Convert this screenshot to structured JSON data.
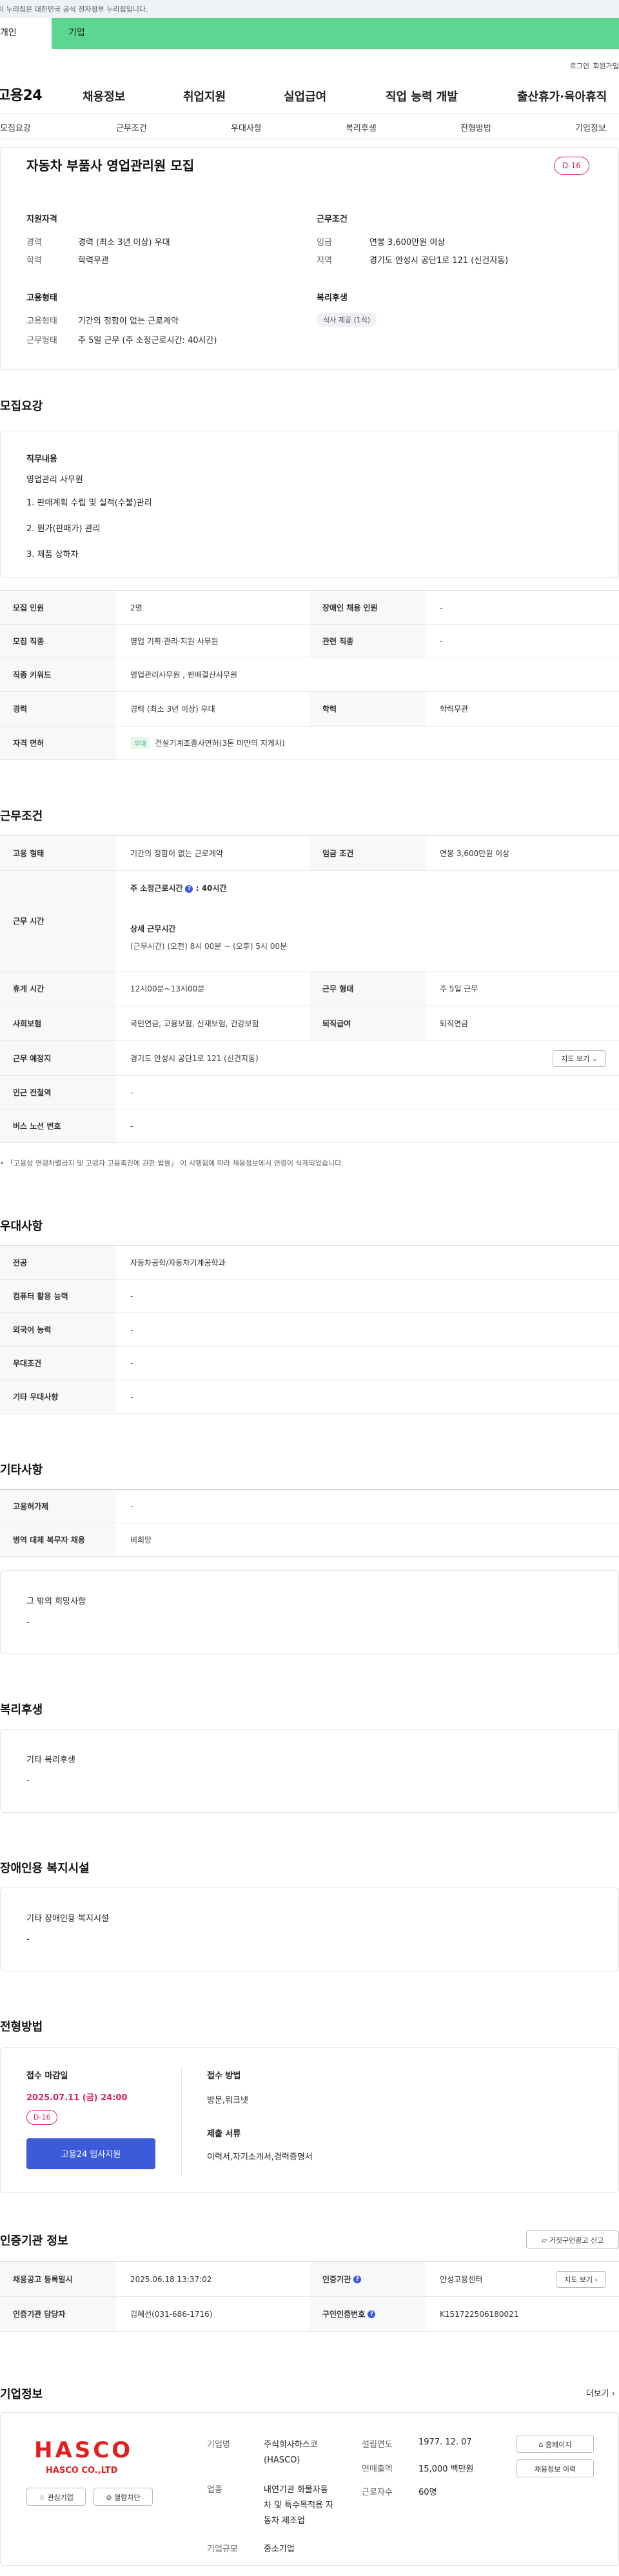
{
  "gov_bar": {
    "text": "이 누리집은 대한민국 공식 전자정부 누리집입니다."
  },
  "top_tabs": {
    "person": "개인",
    "biz": "기업"
  },
  "util": {
    "login": "로그인",
    "join": "회원가입"
  },
  "gnb": {
    "logo": "고용24",
    "items": [
      "채용정보",
      "취업지원",
      "실업급여",
      "직업 능력 개발",
      "출산휴가·육아휴직"
    ]
  },
  "anchor_tabs": [
    "모집요강",
    "근무조건",
    "우대사항",
    "복리후생",
    "전형방법",
    "기업정보"
  ],
  "summary": {
    "title": "자동차 부품사 영업관리원 모집",
    "dday": "D-16",
    "qual_title": "지원자격",
    "career_label": "경력",
    "career_value": "경력 (최소 3년 이상) 우대",
    "edu_label": "학력",
    "edu_value": "학력무관",
    "work_title": "근무조건",
    "wage_label": "임금",
    "wage_value": "연봉 3,600만원 이상",
    "region_label": "지역",
    "region_value": "경기도 안성시 공단1로 121 (신건지동)",
    "emp_title": "고용형태",
    "emp_type_label": "고용형태",
    "emp_type_value": "기간의 정함이 없는 근로계약",
    "work_form_label": "근무형태",
    "work_form_value": "주 5일 근무 (주 소정근로시간: 40시간)",
    "welfare_title": "복리후생",
    "welfare_tag": "식사 제공 (1식)"
  },
  "recruit": {
    "section": "모집요강",
    "duty_title": "직무내용",
    "duty_lines": [
      "영업관리 사무원",
      "1. 판매계획 수립 및 실적(수불)관리",
      "2. 원가(판매가) 관리",
      "3. 제품 상하차"
    ],
    "rows": [
      {
        "th1": "모집 인원",
        "td1": "2명",
        "th2": "장애인 채용 인원",
        "td2": "-"
      },
      {
        "th1": "모집 직종",
        "td1": "영업 기획·관리·지원 사무원",
        "th2": "관련 직종",
        "td2": "-"
      }
    ],
    "keyword_label": "직종 키워드",
    "keyword_value": "영업관리사무원 , 판매결산사무원",
    "career_label": "경력",
    "career_value": "경력 (최소 3년 이상) 우대",
    "edu_label": "학력",
    "edu_value": "학력무관",
    "license_label": "자격 면허",
    "license_badge": "우대",
    "license_value": "건설기계조종사면허(3톤 미만의 지게차)"
  },
  "conditions": {
    "section": "근무조건",
    "emp_label": "고용 형태",
    "emp_value": "기간의 정함이 없는 근로계약",
    "wage_label": "임금 조건",
    "wage_value": "연봉 3,600만원 이상",
    "hours_label": "근무 시간",
    "hours_main": "주 소정근로시간",
    "hours_main_value": ": 40시간",
    "hours_detail_title": "상세 근무시간",
    "hours_detail": "(근무시간) (오전) 8시 00분 ~ (오후) 5시 00분",
    "rest_label": "휴게 시간",
    "rest_value": "12시00분~13시00분",
    "form_label": "근무 형태",
    "form_value": "주 5일 근무",
    "ins_label": "사회보험",
    "ins_value": "국민연금, 고용보험, 산재보험, 건강보험",
    "retire_label": "퇴직급여",
    "retire_value": "퇴직연금",
    "place_label": "근무 예정지",
    "place_value": "경기도 안성시 공단1로 121 (신건지동)",
    "map_btn": "지도 보기",
    "subway_label": "인근 전철역",
    "subway_value": "-",
    "bus_label": "버스 노선 번호",
    "bus_value": "-",
    "note": "「고용상 연령차별금지 및 고령자 고용촉진에 관한 법률」 이 시행됨에 따라 채용정보에서 연령이 삭제되었습니다."
  },
  "preference": {
    "section": "우대사항",
    "rows": [
      {
        "th": "전공",
        "td": "자동차공학/자동차기계공학과"
      },
      {
        "th": "컴퓨터 활용 능력",
        "td": "-"
      },
      {
        "th": "외국어 능력",
        "td": "-"
      },
      {
        "th": "우대조건",
        "td": "-"
      },
      {
        "th": "기타 우대사항",
        "td": "-"
      }
    ]
  },
  "etc": {
    "section": "기타사항",
    "rows": [
      {
        "th": "고용허가제",
        "td": "-"
      },
      {
        "th": "병역 대체 복무자 채용",
        "td": "비희망"
      }
    ],
    "box_title": "그 밖의 희망사항",
    "box_value": "-"
  },
  "welfare": {
    "section": "복리후생",
    "box_title": "기타 복리후생",
    "box_value": "-"
  },
  "disabled": {
    "section": "장애인용 복지시설",
    "box_title": "기타 장애인용 복지시설",
    "box_value": "-"
  },
  "screening": {
    "section": "전형방법",
    "deadline_label": "접수 마감일",
    "deadline_value": "2025.07.11 (금) 24:00",
    "dday": "D-16",
    "apply_btn": "고용24 입사지원",
    "method_label": "접수 방법",
    "method_value": "방문,워크넷",
    "docs_label": "제출 서류",
    "docs_value": "이력서,자기소개서,경력증명서"
  },
  "cert": {
    "section": "인증기관 정보",
    "report_btn": "거짓구인광고 신고",
    "reg_label": "채용공고 등록일시",
    "reg_value": "2025.06.18 13:37:02",
    "org_label": "인증기관",
    "org_value": "안성고용센터",
    "map_btn": "지도 보기",
    "manager_label": "인증기관 담당자",
    "manager_value": "김혜선(031-686-1716)",
    "cert_no_label": "구인인증번호",
    "cert_no_value": "K151722506180021"
  },
  "company": {
    "section": "기업정보",
    "more": "더보기",
    "logo_main": "HASCO",
    "logo_sub": "HASCO CO.,LTD",
    "interest_btn": "관심기업",
    "block_btn": "열람차단",
    "name_label": "기업명",
    "name_value": "주식회사하스코 (HASCO)",
    "industry_label": "업종",
    "industry_value": "내연기관 화물자동차 및 특수목적용 자동차 제조업",
    "size_label": "기업규모",
    "size_value": "중소기업",
    "founded_label": "설립연도",
    "founded_value": "1977. 12. 07",
    "sales_label": "연매출액",
    "sales_value": "15,000 백만원",
    "staff_label": "근로자수",
    "staff_value": "60명",
    "homepage_btn": "홈페이지",
    "jobs_btn": "채용정보 이력"
  }
}
